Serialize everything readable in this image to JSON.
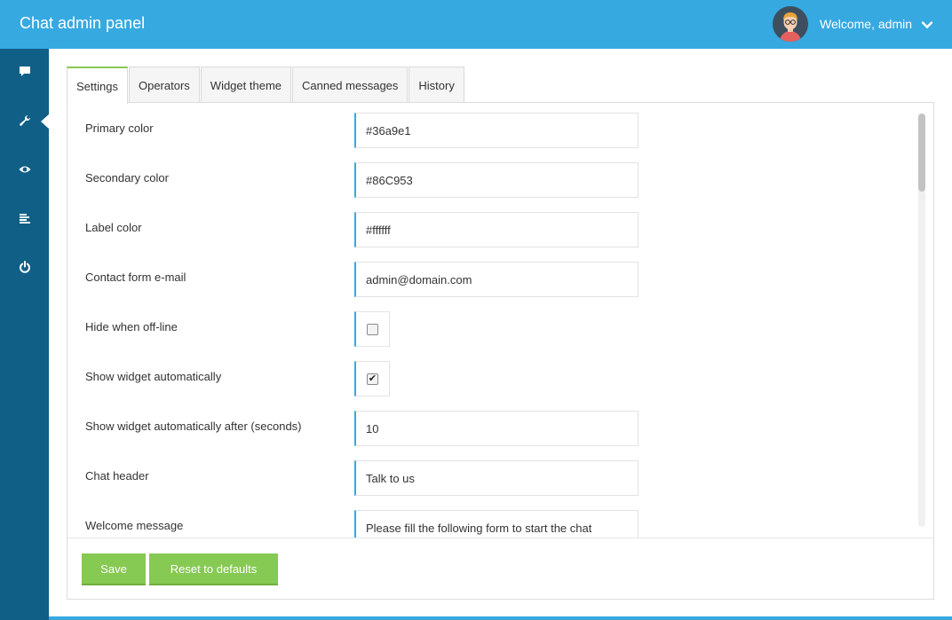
{
  "app": {
    "title": "Chat admin panel",
    "welcome": "Welcome, admin",
    "accent_color": "#36a9e1",
    "sidebar_color": "#105f86",
    "button_color": "#86c953"
  },
  "sidebar": {
    "items": [
      {
        "icon": "chat-icon",
        "active": false
      },
      {
        "icon": "wrench-icon",
        "active": true
      },
      {
        "icon": "eye-icon",
        "active": false
      },
      {
        "icon": "list-icon",
        "active": false
      },
      {
        "icon": "power-icon",
        "active": false
      }
    ]
  },
  "tabs": [
    {
      "label": "Settings",
      "active": true
    },
    {
      "label": "Operators",
      "active": false
    },
    {
      "label": "Widget theme",
      "active": false
    },
    {
      "label": "Canned messages",
      "active": false
    },
    {
      "label": "History",
      "active": false
    }
  ],
  "settings": {
    "primary_color": {
      "label": "Primary color",
      "value": "#36a9e1"
    },
    "secondary_color": {
      "label": "Secondary color",
      "value": "#86C953"
    },
    "label_color": {
      "label": "Label color",
      "value": "#ffffff"
    },
    "contact_email": {
      "label": "Contact form e-mail",
      "value": "admin@domain.com"
    },
    "hide_offline": {
      "label": "Hide when off-line",
      "checked": false
    },
    "show_auto": {
      "label": "Show widget automatically",
      "checked": true,
      "check_glyph": "✔"
    },
    "show_auto_after": {
      "label": "Show widget automatically after (seconds)",
      "value": "10"
    },
    "chat_header": {
      "label": "Chat header",
      "value": "Talk to us"
    },
    "welcome_message": {
      "label": "Welcome message",
      "value": "Please fill the following form to start the chat"
    }
  },
  "actions": {
    "save": "Save",
    "reset": "Reset to defaults"
  }
}
